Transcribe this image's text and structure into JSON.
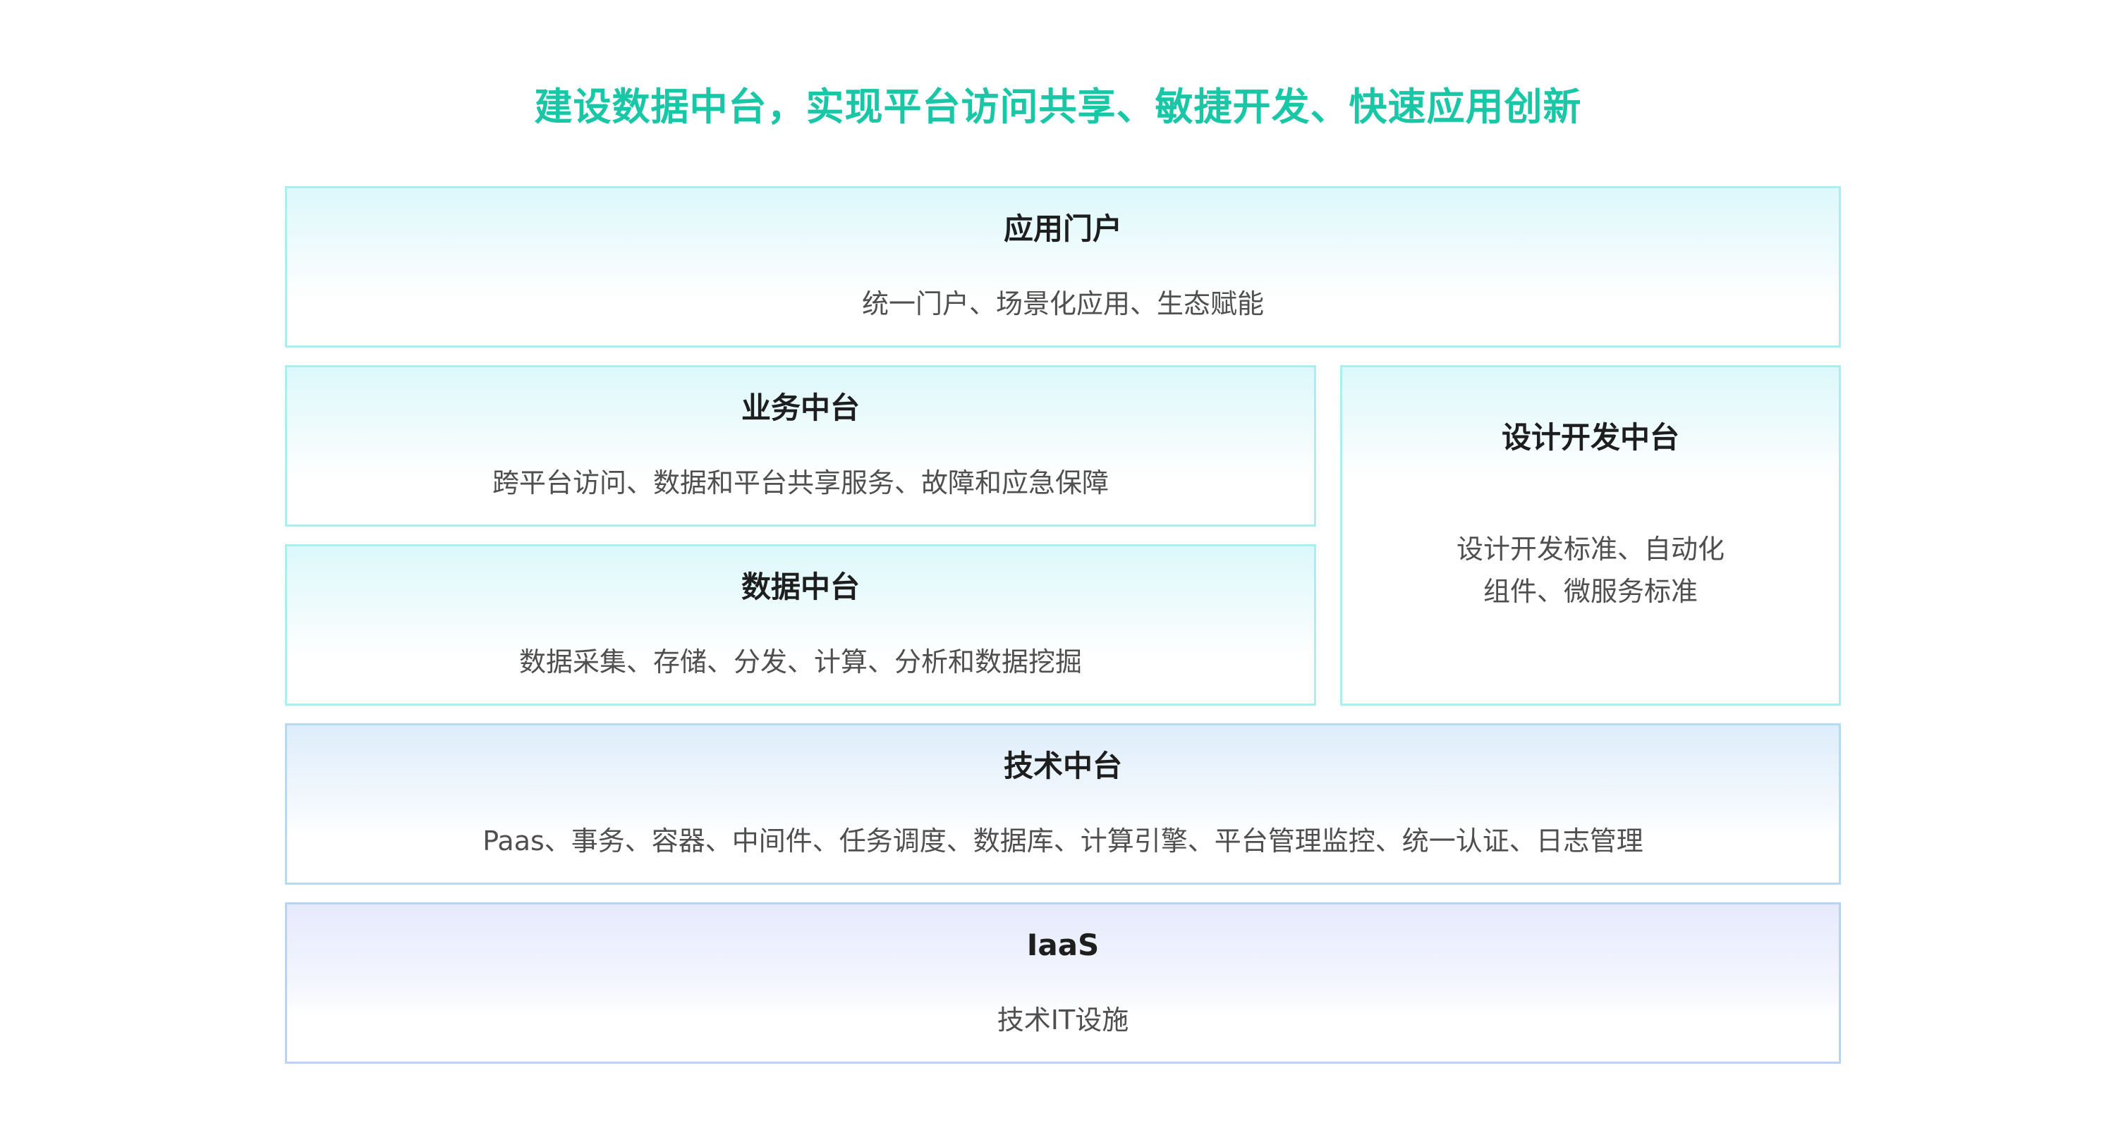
{
  "headline": "建设数据中台，实现平台访问共享、敏捷开发、快速应用创新",
  "layers": {
    "portal": {
      "title": "应用门户",
      "desc": "统一门户、场景化应用、生态赋能"
    },
    "business": {
      "title": "业务中台",
      "desc": "跨平台访问、数据和平台共享服务、故障和应急保障"
    },
    "data": {
      "title": "数据中台",
      "desc": "数据采集、存储、分发、计算、分析和数据挖掘"
    },
    "design": {
      "title": "设计开发中台",
      "desc": "设计开发标准、自动化\n组件、微服务标准"
    },
    "tech": {
      "title": "技术中台",
      "desc": "Paas、事务、容器、中间件、任务调度、数据库、计算引擎、平台管理监控、统一认证、日志管理"
    },
    "iaas": {
      "title": "IaaS",
      "desc": "技术IT设施"
    }
  },
  "colors": {
    "headline": "#19c7a6",
    "border_teal": "#aeeced",
    "border_blue": "#b6daef",
    "title_text": "#1e1e1e",
    "desc_text": "#4f4f4f"
  }
}
